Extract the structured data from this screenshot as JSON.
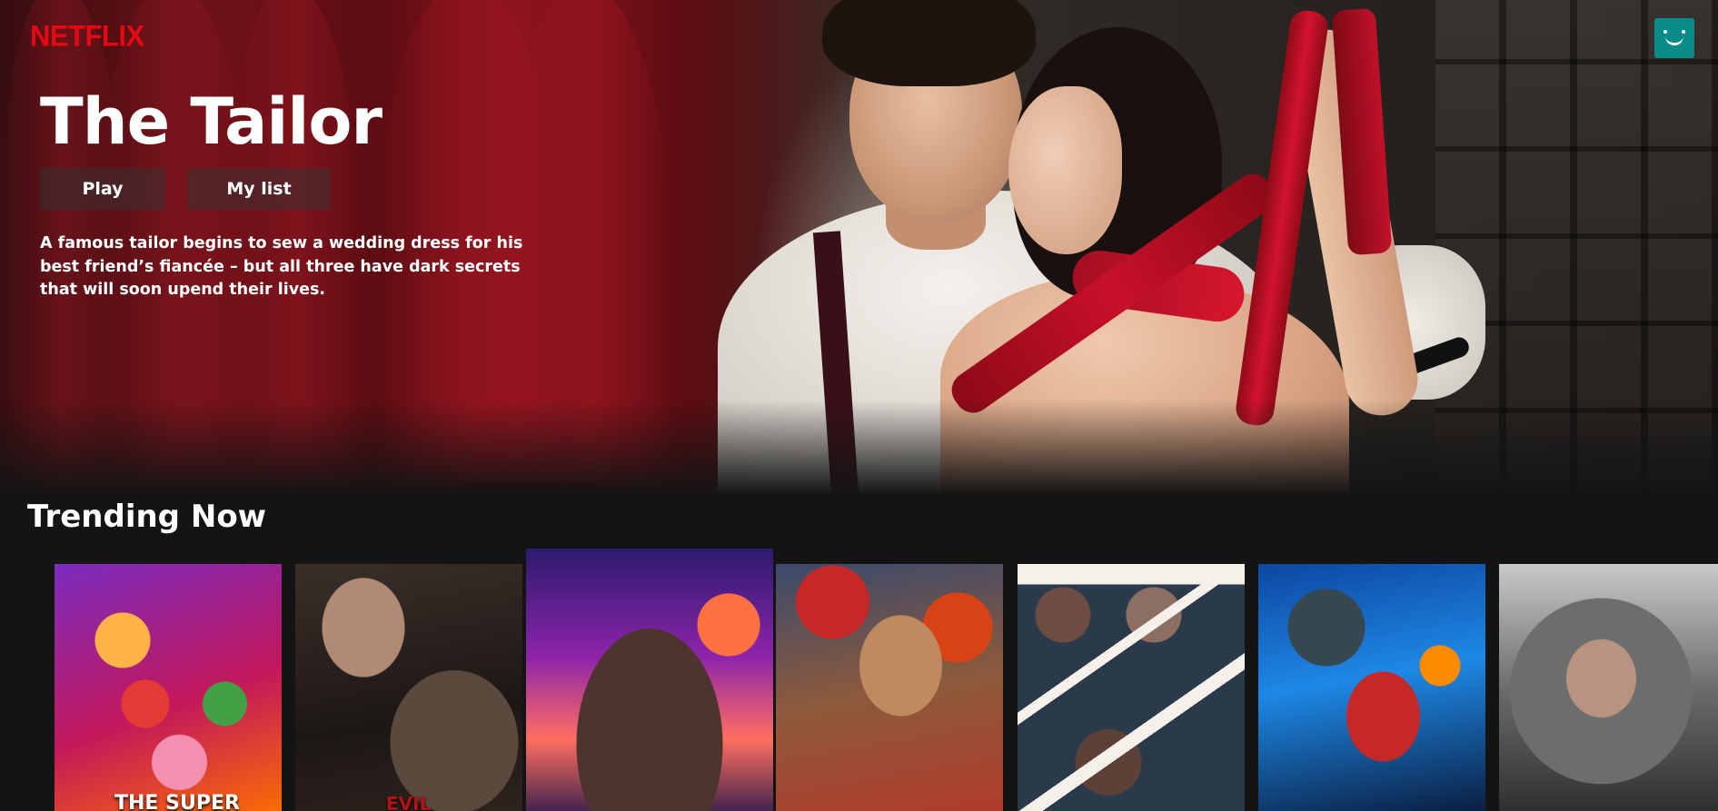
{
  "header": {
    "logo_text": "NETFLIX",
    "logo_color": "#e50914",
    "profile_icon": "smiley-face-icon",
    "profile_color": "#0b8a8a"
  },
  "hero": {
    "title": "The Tailor",
    "play_label": "Play",
    "my_list_label": "My list",
    "description": "A famous tailor begins to sew a wedding dress for his best friend’s fiancée – but all three have dark secrets that will soon upend their lives."
  },
  "trending": {
    "title": "Trending Now",
    "posters": [
      {
        "name": "poster-super-mario",
        "caption": "THE SUPER"
      },
      {
        "name": "poster-evil-dead",
        "caption": "EVIL"
      },
      {
        "name": "poster-guardians",
        "caption": ""
      },
      {
        "name": "poster-dungeons-dragons",
        "caption": ""
      },
      {
        "name": "poster-air",
        "caption": ""
      },
      {
        "name": "poster-ant-man",
        "caption": ""
      },
      {
        "name": "poster-the-mother",
        "caption": ""
      }
    ]
  }
}
